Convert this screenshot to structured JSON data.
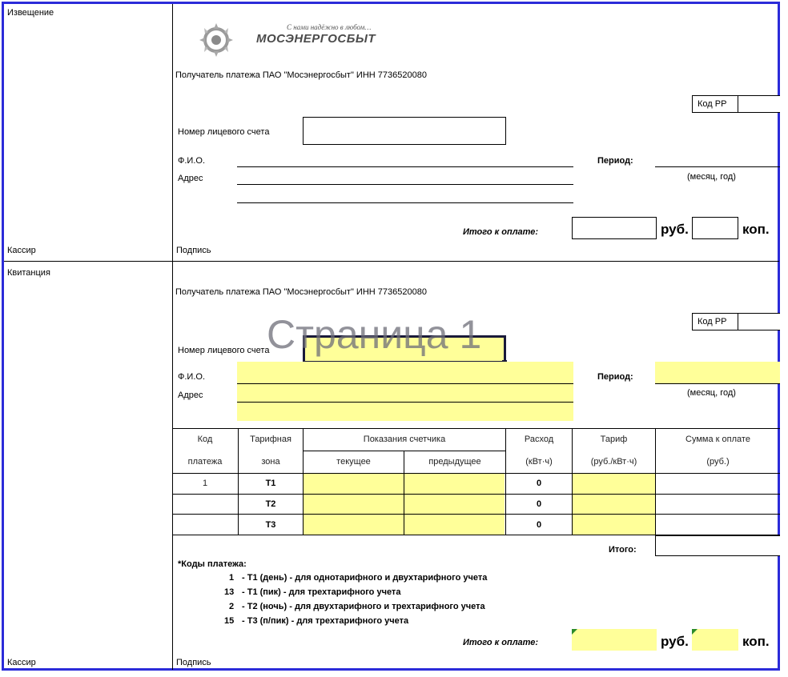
{
  "notice": {
    "label": "Извещение",
    "cashier": "Кассир",
    "slogan": "С нами надёжно в любом…",
    "logo_text": "МОСЭНЕРГОСБЫТ",
    "recipient": "Получатель платежа ПАО \"Мосэнергосбыт\" ИНН 7736520080",
    "kod_rr": "Код РР",
    "account_label": "Номер лицевого счета",
    "fio_label": "Ф.И.О.",
    "address_label": "Адрес",
    "period_label": "Период:",
    "period_hint": "(месяц, год)",
    "total_label": "Итого к оплате:",
    "rub": "руб.",
    "kop": "коп.",
    "signature": "Подпись"
  },
  "receipt": {
    "label": "Квитанция",
    "cashier": "Кассир",
    "recipient": "Получатель платежа ПАО \"Мосэнергосбыт\" ИНН 7736520080",
    "kod_rr": "Код РР",
    "watermark": "Страница 1",
    "account_label": "Номер лицевого счета",
    "fio_label": "Ф.И.О.",
    "address_label": "Адрес",
    "period_label": "Период:",
    "period_hint": "(месяц, год)",
    "table": {
      "h_code_1": "Код",
      "h_code_2": "платежа",
      "h_zone_1": "Тарифная",
      "h_zone_2": "зона",
      "h_readings": "Показания счетчика",
      "h_current": "текущее",
      "h_previous": "предыдущее",
      "h_usage_1": "Расход",
      "h_usage_2": "(кВт·ч)",
      "h_tariff_1": "Тариф",
      "h_tariff_2": "(руб./кВт·ч)",
      "h_sum_1": "Сумма к оплате",
      "h_sum_2": "(руб.)",
      "rows": [
        {
          "code": "1",
          "zone": "Т1",
          "usage": "0"
        },
        {
          "code": "",
          "zone": "Т2",
          "usage": "0"
        },
        {
          "code": "",
          "zone": "Т3",
          "usage": "0"
        }
      ],
      "itogo": "Итого:"
    },
    "codes": {
      "title": "*Коды платежа:",
      "items": [
        {
          "num": "1",
          "text": "- Т1 (день) - для однотарифного и двухтарифного учета"
        },
        {
          "num": "13",
          "text": "- Т1 (пик)   - для трехтарифного учета"
        },
        {
          "num": "2",
          "text": "- Т2 (ночь) - для двухтарифного и трехтарифного учета"
        },
        {
          "num": "15",
          "text": "- Т3 (п/пик) - для трехтарифного учета"
        }
      ]
    },
    "total_label": "Итого к оплате:",
    "rub": "руб.",
    "kop": "коп.",
    "signature": "Подпись"
  },
  "colors": {
    "frame": "#2b2bd9",
    "highlight": "#ffff99",
    "corner_marker": "#2a8a2a"
  }
}
